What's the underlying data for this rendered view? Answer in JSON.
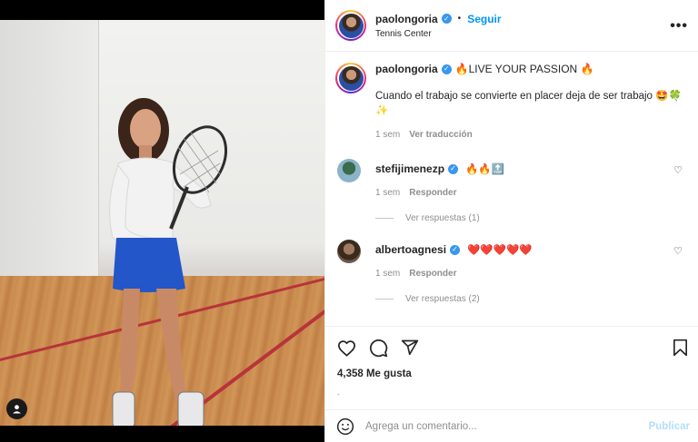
{
  "post": {
    "username": "paolongoria",
    "follow_label": "Seguir",
    "location": "Tennis Center",
    "more_label": "•••"
  },
  "caption": {
    "username": "paolongoria",
    "title": "🔥LIVE YOUR PASSION 🔥",
    "text": "Cuando el trabajo se convierte en placer deja de ser trabajo 🤩🍀✨",
    "time": "1 sem",
    "translate_label": "Ver traducción"
  },
  "comments": [
    {
      "username": "stefijimenezp",
      "text": "🔥🔥🔝",
      "time": "1 sem",
      "reply_label": "Responder",
      "replies_label": "Ver respuestas (1)"
    },
    {
      "username": "albertoagnesi",
      "text": "❤️❤️❤️❤️❤️",
      "time": "1 sem",
      "reply_label": "Responder",
      "replies_label": "Ver respuestas (2)"
    }
  ],
  "actions": {
    "likes": "4,358 Me gusta",
    "small_text": "-"
  },
  "comment_box": {
    "placeholder": "Agrega un comentario...",
    "publish_label": "Publicar"
  },
  "icons": {
    "like": "heart-icon",
    "comment": "comment-icon",
    "share": "share-icon",
    "save": "bookmark-icon",
    "emoji": "emoji-icon",
    "user": "user-tag-icon"
  },
  "colors": {
    "link_blue": "#0095f6",
    "verified_blue": "#3897f0",
    "muted": "#8e8e8e",
    "publish_disabled": "#b2dffc"
  }
}
